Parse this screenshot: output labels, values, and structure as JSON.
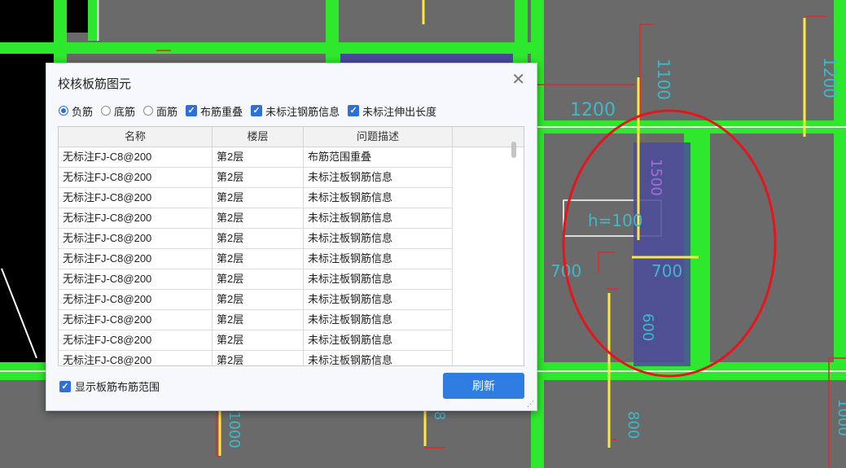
{
  "dialog": {
    "title": "校核板筋图元",
    "close_glyph": "✕",
    "filters": [
      {
        "type": "radio",
        "label": "负筋",
        "checked": true
      },
      {
        "type": "radio",
        "label": "底筋",
        "checked": false
      },
      {
        "type": "radio",
        "label": "面筋",
        "checked": false
      },
      {
        "type": "checkbox",
        "label": "布筋重叠",
        "checked": true
      },
      {
        "type": "checkbox",
        "label": "未标注钢筋信息",
        "checked": true
      },
      {
        "type": "checkbox",
        "label": "未标注伸出长度",
        "checked": true
      }
    ],
    "table": {
      "columns": [
        "名称",
        "楼层",
        "问题描述"
      ],
      "rows": [
        [
          "无标注FJ-C8@200",
          "第2层",
          "布筋范围重叠"
        ],
        [
          "无标注FJ-C8@200",
          "第2层",
          "未标注板钢筋信息"
        ],
        [
          "无标注FJ-C8@200",
          "第2层",
          "未标注板钢筋信息"
        ],
        [
          "无标注FJ-C8@200",
          "第2层",
          "未标注板钢筋信息"
        ],
        [
          "无标注FJ-C8@200",
          "第2层",
          "未标注板钢筋信息"
        ],
        [
          "无标注FJ-C8@200",
          "第2层",
          "未标注板钢筋信息"
        ],
        [
          "无标注FJ-C8@200",
          "第2层",
          "未标注板钢筋信息"
        ],
        [
          "无标注FJ-C8@200",
          "第2层",
          "未标注板钢筋信息"
        ],
        [
          "无标注FJ-C8@200",
          "第2层",
          "未标注板钢筋信息"
        ],
        [
          "无标注FJ-C8@200",
          "第2层",
          "未标注板钢筋信息"
        ],
        [
          "无标注FJ-C8@200",
          "第2层",
          "未标注板钢筋信息"
        ]
      ]
    },
    "show_range_label": "显示板筋布筋范围",
    "show_range_checked": true,
    "refresh_label": "刷新"
  },
  "canvas": {
    "labels": [
      "1200",
      "1100",
      "1200",
      "h=100",
      "700",
      "700",
      "1500",
      "600",
      "1000",
      "8",
      "800",
      "1000"
    ],
    "colors": {
      "background": "#6a6a6a",
      "beam": "#2ee82e",
      "rebar_yellow": "#ffe93a",
      "rebar_red": "#e8242a",
      "dim_text": "#3fb8c8",
      "highlight": "#4a4a9a",
      "annotation_circle": "#e8141c"
    }
  }
}
